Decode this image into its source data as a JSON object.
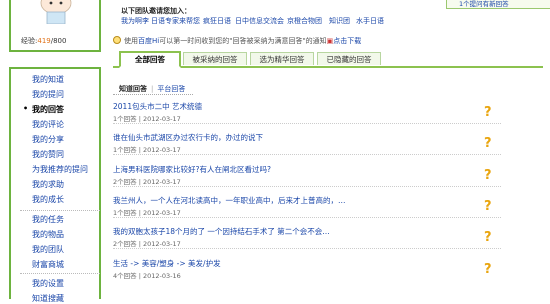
{
  "sidebar": {
    "exp_label": "经验:",
    "exp_current": "419",
    "exp_sep": "/",
    "exp_total": "800",
    "nav": [
      {
        "label": "我的知道"
      },
      {
        "label": "我的提问"
      },
      {
        "label": "我的回答",
        "active": true
      },
      {
        "label": "我的评论"
      },
      {
        "label": "我的分享"
      },
      {
        "label": "我的赞同"
      },
      {
        "label": "为我推荐的提问"
      },
      {
        "label": "我的求助"
      },
      {
        "label": "我的成长"
      },
      {
        "label": "我的任务"
      },
      {
        "label": "我的物品"
      },
      {
        "label": "我的团队"
      },
      {
        "label": "财富商城"
      },
      {
        "label": "我的设置"
      },
      {
        "label": "知道搜藏"
      }
    ]
  },
  "invite": {
    "title": "以下团队邀请您加入：",
    "teams": [
      "我为啊李",
      "日语专家来帮您",
      "疯狂日语",
      "日中信息交流会",
      "京橙合物团",
      "知识团",
      "水手日语"
    ]
  },
  "topright": {
    "text": "1个提问有新回答"
  },
  "notice": {
    "pre": "使用",
    "baidu": "百度Hi",
    "mid": "可以第一时间收到您的\"回答被采纳为满意回答\"的通知",
    "click": "点击下载"
  },
  "tabs": [
    "全部回答",
    "被采纳的回答",
    "选为精华回答",
    "已隐藏的回答"
  ],
  "subtabs": {
    "on": "知道回答",
    "bar": "|",
    "off": "平台回答"
  },
  "questions": [
    {
      "title": "2011包头市二中  艺术统德",
      "meta": "1个回答 | 2012-03-17"
    },
    {
      "title": "谁在仙头市武湖区办过农行卡的，办过的说下",
      "meta": "1个回答 | 2012-03-17"
    },
    {
      "title": "上海男科医院哪家比较好?有人在闸北区看过吗?",
      "meta": "2个回答 | 2012-03-17"
    },
    {
      "title": "我兰州人，一个人在河北读高中，一年职业高中，后来才上普高的，…",
      "meta": "1个回答 | 2012-03-17"
    },
    {
      "title": "我的双胞太孩子18个月的了  一个因持结石手术了  第二个会不会…",
      "meta": "2个回答 | 2012-03-17"
    },
    {
      "title": "生活 -> 美容/塑身 -> 美发/护发",
      "meta": "4个回答 | 2012-03-16"
    }
  ],
  "colors": {
    "accent_green": "#6db33f",
    "link_blue": "#1a46a8",
    "question_orange": "#e9a50f",
    "exp_orange": "#e0731c"
  }
}
